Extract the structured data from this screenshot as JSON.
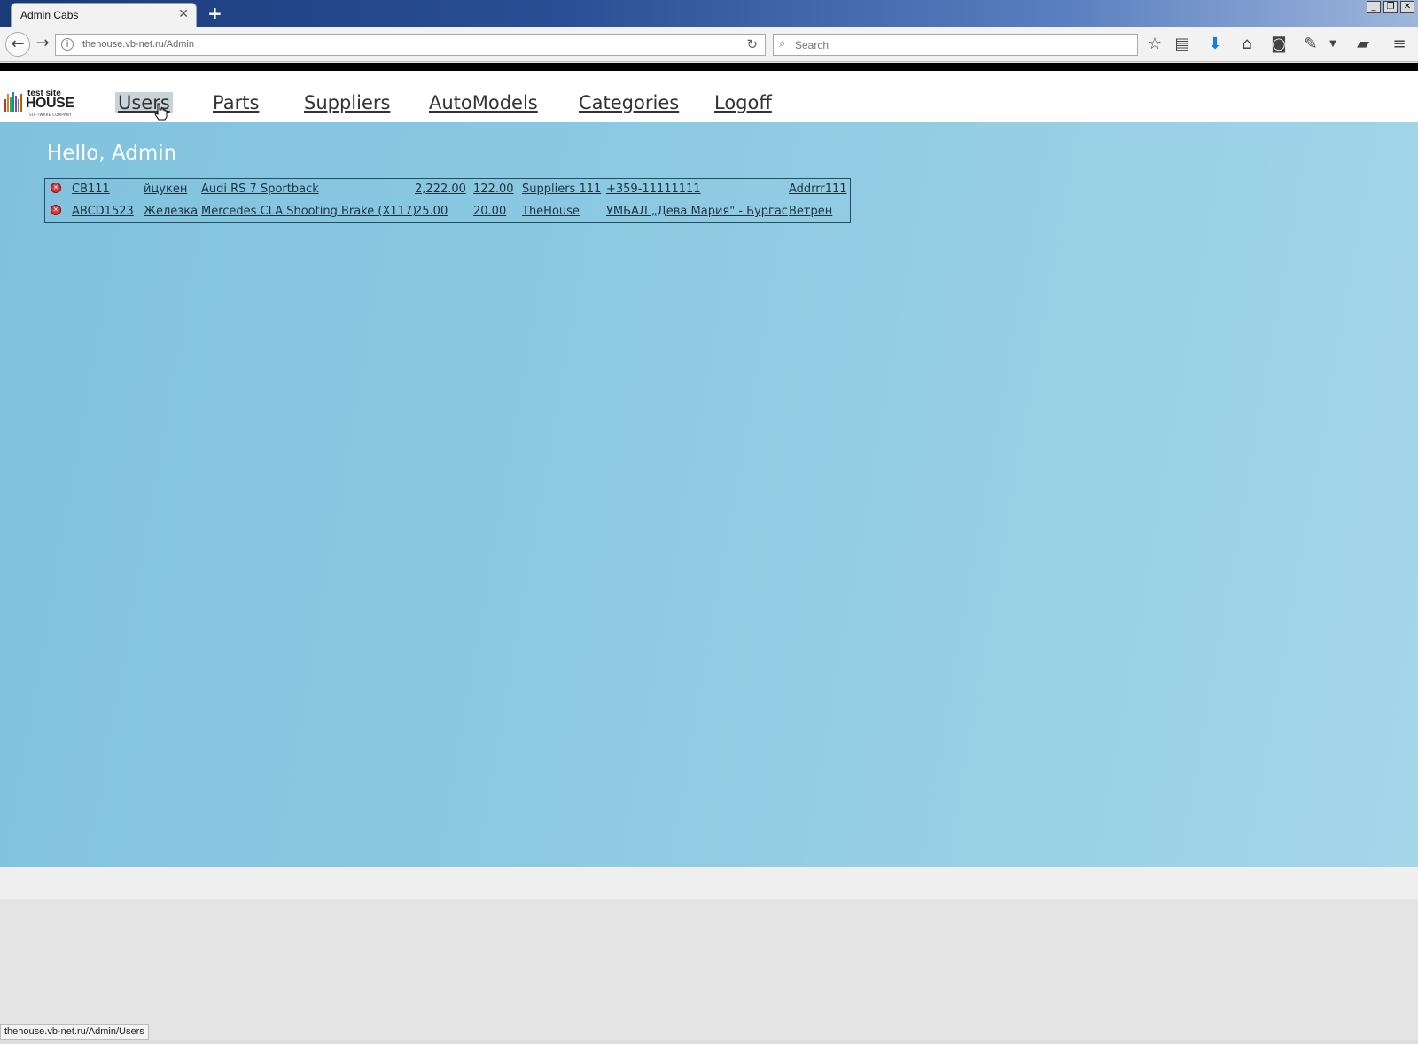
{
  "browser": {
    "tab_title": "Admin Cabs",
    "url": "thehouse.vb-net.ru/Admin",
    "search_placeholder": "Search",
    "status_text": "thehouse.vb-net.ru/Admin/Users"
  },
  "logo": {
    "small": "test site",
    "big": "HOUSE",
    "tag": "SOFTWARE COMPANY"
  },
  "menu": [
    {
      "label": "Users",
      "active": true
    },
    {
      "label": "Parts"
    },
    {
      "label": "Suppliers"
    },
    {
      "label": "AutoModels"
    },
    {
      "label": "Categories"
    },
    {
      "label": "Logoff"
    }
  ],
  "greeting": "Hello, Admin",
  "parts": [
    {
      "code": "CB111",
      "name": "йцукен",
      "model": "Audi RS 7 Sportback",
      "price": "2,222.00",
      "price2": "122.00",
      "supplier": "Suppliers 111",
      "phone": "+359-11111111",
      "address": "Addrrr111"
    },
    {
      "code": "ABCD1523",
      "name": "Железка",
      "model": "Mercedes CLA Shooting Brake (X117)",
      "price": "25.00",
      "price2": "20.00",
      "supplier": "TheHouse",
      "phone": "УМБАЛ „Дева Мария\" - Бургас",
      "address": "Ветрен"
    }
  ],
  "colors": {
    "main_bg": "#8dcae2",
    "header_bg": "#ffffff",
    "link": "#1f3140",
    "delete": "#d23a3a"
  }
}
